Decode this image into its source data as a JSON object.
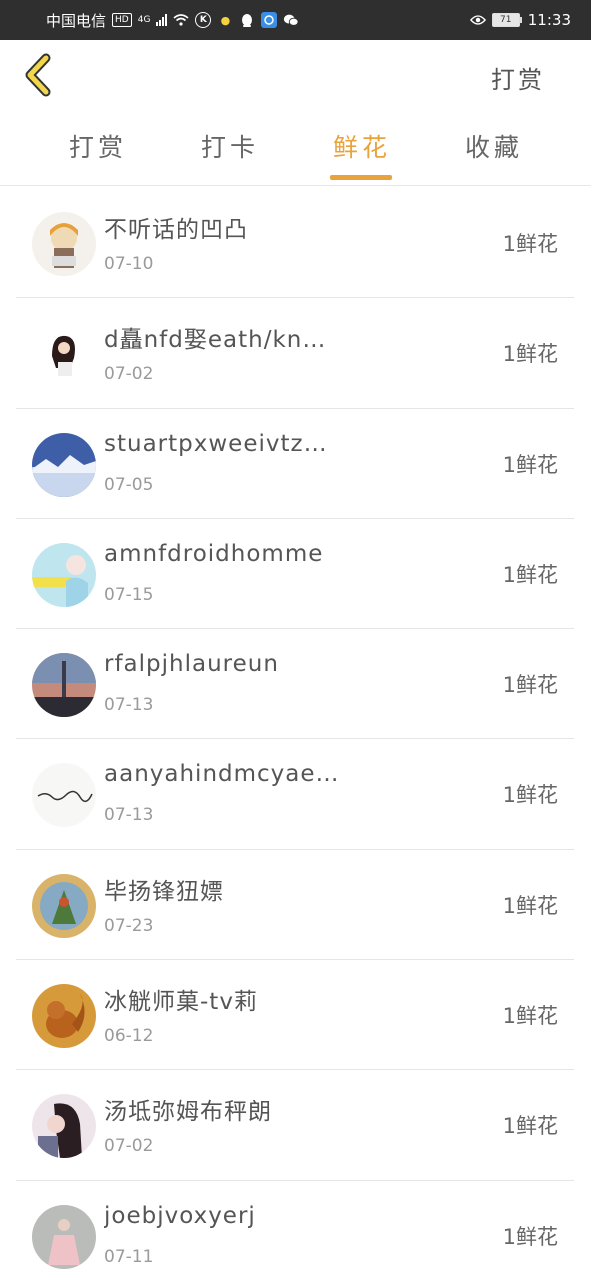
{
  "status_bar": {
    "carrier": "中国电信",
    "hd": "HD",
    "network": "4G",
    "battery": "71",
    "time": "11:33"
  },
  "header": {
    "action_label": "打赏"
  },
  "tabs": [
    {
      "label": "打赏"
    },
    {
      "label": "打卡"
    },
    {
      "label": "鲜花"
    },
    {
      "label": "收藏"
    }
  ],
  "active_tab": "鲜花",
  "accent_color": "#e8a33d",
  "list": [
    {
      "name": "不听话的凹凸",
      "date": "07-10",
      "amount": "1鲜花"
    },
    {
      "name": "d矗nfd娶eath/kn…",
      "date": "07-02",
      "amount": "1鲜花"
    },
    {
      "name": "stuartpxweeivtzman",
      "date": "07-05",
      "amount": "1鲜花"
    },
    {
      "name": "amnfdroidhomme",
      "date": "07-15",
      "amount": "1鲜花"
    },
    {
      "name": "rfalpjhlaureun",
      "date": "07-13",
      "amount": "1鲜花"
    },
    {
      "name": "aanyahindmcyaerch",
      "date": "07-13",
      "amount": "1鲜花"
    },
    {
      "name": "毕扬锋狃嫖",
      "date": "07-23",
      "amount": "1鲜花"
    },
    {
      "name": "冰觥师菓-tv莉",
      "date": "06-12",
      "amount": "1鲜花"
    },
    {
      "name": "汤坻弥姆布秤朗",
      "date": "07-02",
      "amount": "1鲜花"
    },
    {
      "name": "joebjvoxyerj",
      "date": "07-11",
      "amount": "1鲜花"
    }
  ]
}
